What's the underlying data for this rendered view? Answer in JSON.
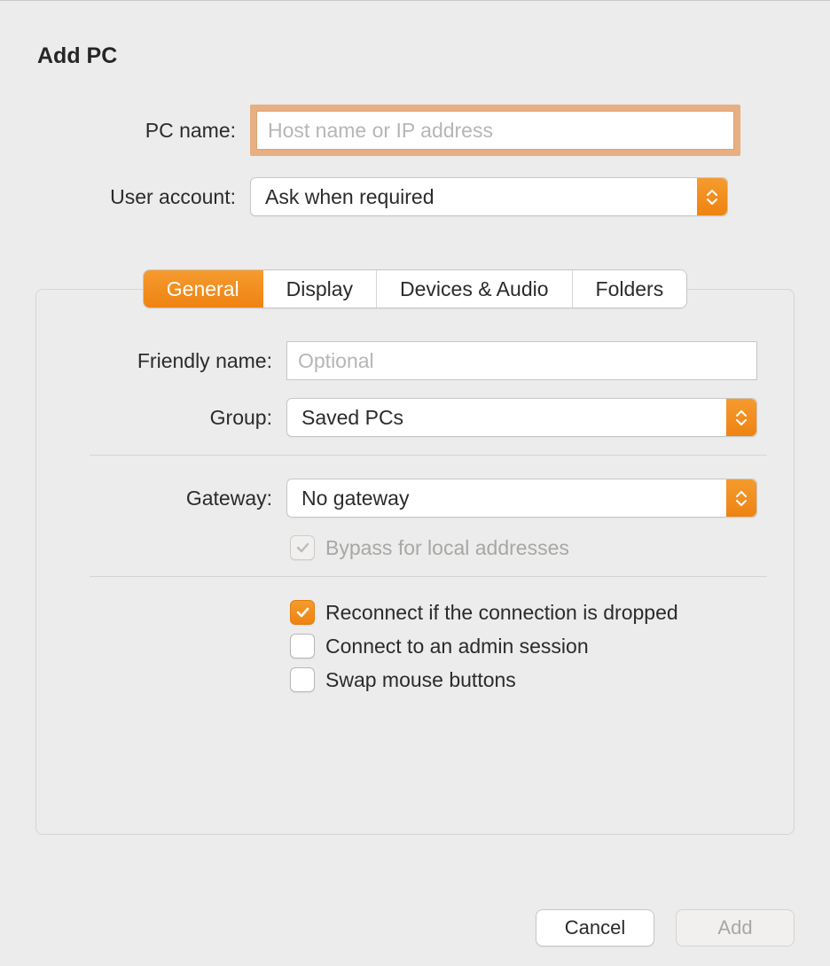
{
  "dialog": {
    "title": "Add PC"
  },
  "top": {
    "pc_name_label": "PC name:",
    "pc_name_placeholder": "Host name or IP address",
    "pc_name_value": "",
    "user_account_label": "User account:",
    "user_account_value": "Ask when required"
  },
  "tabs": {
    "general": "General",
    "display": "Display",
    "devices": "Devices & Audio",
    "folders": "Folders"
  },
  "general": {
    "friendly_label": "Friendly name:",
    "friendly_placeholder": "Optional",
    "friendly_value": "",
    "group_label": "Group:",
    "group_value": "Saved PCs",
    "gateway_label": "Gateway:",
    "gateway_value": "No gateway",
    "bypass_label": "Bypass for local addresses",
    "bypass_checked": true,
    "bypass_disabled": true,
    "reconnect_label": "Reconnect if the connection is dropped",
    "reconnect_checked": true,
    "admin_label": "Connect to an admin session",
    "admin_checked": false,
    "swap_label": "Swap mouse buttons",
    "swap_checked": false
  },
  "footer": {
    "cancel": "Cancel",
    "add": "Add"
  }
}
